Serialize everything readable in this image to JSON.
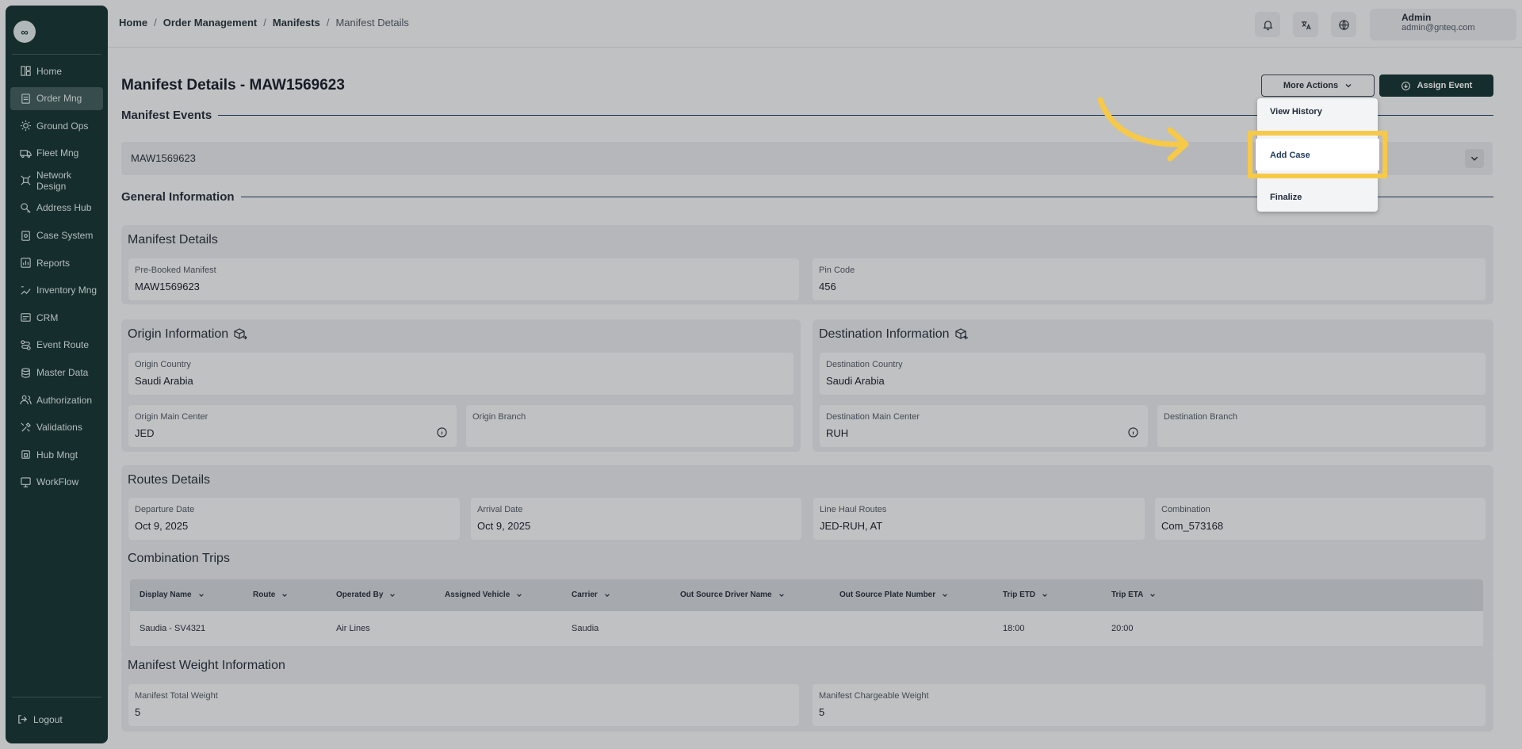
{
  "sidebar": {
    "logo_text": "∞",
    "items": [
      {
        "label": "Home",
        "icon": "home-icon"
      },
      {
        "label": "Order Mng",
        "icon": "order-icon"
      },
      {
        "label": "Ground Ops",
        "icon": "ground-ops-icon"
      },
      {
        "label": "Fleet Mng",
        "icon": "truck-icon"
      },
      {
        "label": "Network Design",
        "icon": "network-icon"
      },
      {
        "label": "Address Hub",
        "icon": "address-icon"
      },
      {
        "label": "Case System",
        "icon": "case-icon"
      },
      {
        "label": "Reports",
        "icon": "reports-icon"
      },
      {
        "label": "Inventory Mng",
        "icon": "inventory-icon"
      },
      {
        "label": "CRM",
        "icon": "crm-icon"
      },
      {
        "label": "Event Route",
        "icon": "route-icon"
      },
      {
        "label": "Master Data",
        "icon": "database-icon"
      },
      {
        "label": "Authorization",
        "icon": "users-icon"
      },
      {
        "label": "Validations",
        "icon": "tools-icon"
      },
      {
        "label": "Hub Mngt",
        "icon": "hub-icon"
      },
      {
        "label": "WorkFlow",
        "icon": "workflow-icon"
      }
    ],
    "active_index": 1,
    "logout_label": "Logout"
  },
  "breadcrumb": [
    "Home",
    "Order Management",
    "Manifests",
    "Manifest Details"
  ],
  "user": {
    "name": "Admin",
    "email": "admin@gnteq.com"
  },
  "page": {
    "title": "Manifest Details - MAW1569623",
    "more_actions_label": "More Actions",
    "assign_event_label": "Assign Event"
  },
  "dropdown": {
    "items": [
      "View History",
      "Add Case",
      "Finalize"
    ],
    "highlighted": "Add Case"
  },
  "manifest_events": {
    "heading": "Manifest Events",
    "value": "MAW1569623"
  },
  "general_information": {
    "heading": "General Information",
    "manifest_details": {
      "title": "Manifest Details",
      "pre_booked_label": "Pre-Booked Manifest",
      "pre_booked_value": "MAW1569623",
      "pin_label": "Pin Code",
      "pin_value": "456"
    },
    "origin": {
      "title": "Origin Information",
      "country_label": "Origin Country",
      "country_value": "Saudi Arabia",
      "main_center_label": "Origin Main Center",
      "main_center_value": "JED",
      "branch_label": "Origin Branch"
    },
    "destination": {
      "title": "Destination Information",
      "country_label": "Destination Country",
      "country_value": "Saudi Arabia",
      "main_center_label": "Destination Main Center",
      "main_center_value": "RUH",
      "branch_label": "Destination Branch"
    },
    "routes": {
      "title": "Routes Details",
      "departure_label": "Departure Date",
      "departure_value": "Oct 9, 2025",
      "arrival_label": "Arrival Date",
      "arrival_value": "Oct 9, 2025",
      "line_haul_label": "Line Haul Routes",
      "line_haul_value": "JED-RUH, AT",
      "combination_label": "Combination",
      "combination_value": "Com_573168",
      "trips_title": "Combination Trips",
      "columns": [
        "Display Name",
        "Route",
        "Operated By",
        "Assigned Vehicle",
        "Carrier",
        "Out Source Driver Name",
        "Out Source Plate Number",
        "Trip ETD",
        "Trip ETA"
      ],
      "rows": [
        [
          "Saudia - SV4321",
          "",
          "Air Lines",
          "",
          "Saudia",
          "",
          "",
          "18:00",
          "20:00"
        ]
      ]
    },
    "weight": {
      "title": "Manifest Weight Information",
      "total_label": "Manifest Total Weight",
      "total_value": "5",
      "chargeable_label": "Manifest Chargeable Weight",
      "chargeable_value": "5"
    }
  },
  "colors": {
    "sidebar_bg": "#0f2f2f",
    "highlight": "#f7c948",
    "accent": "#1e3a5f"
  }
}
